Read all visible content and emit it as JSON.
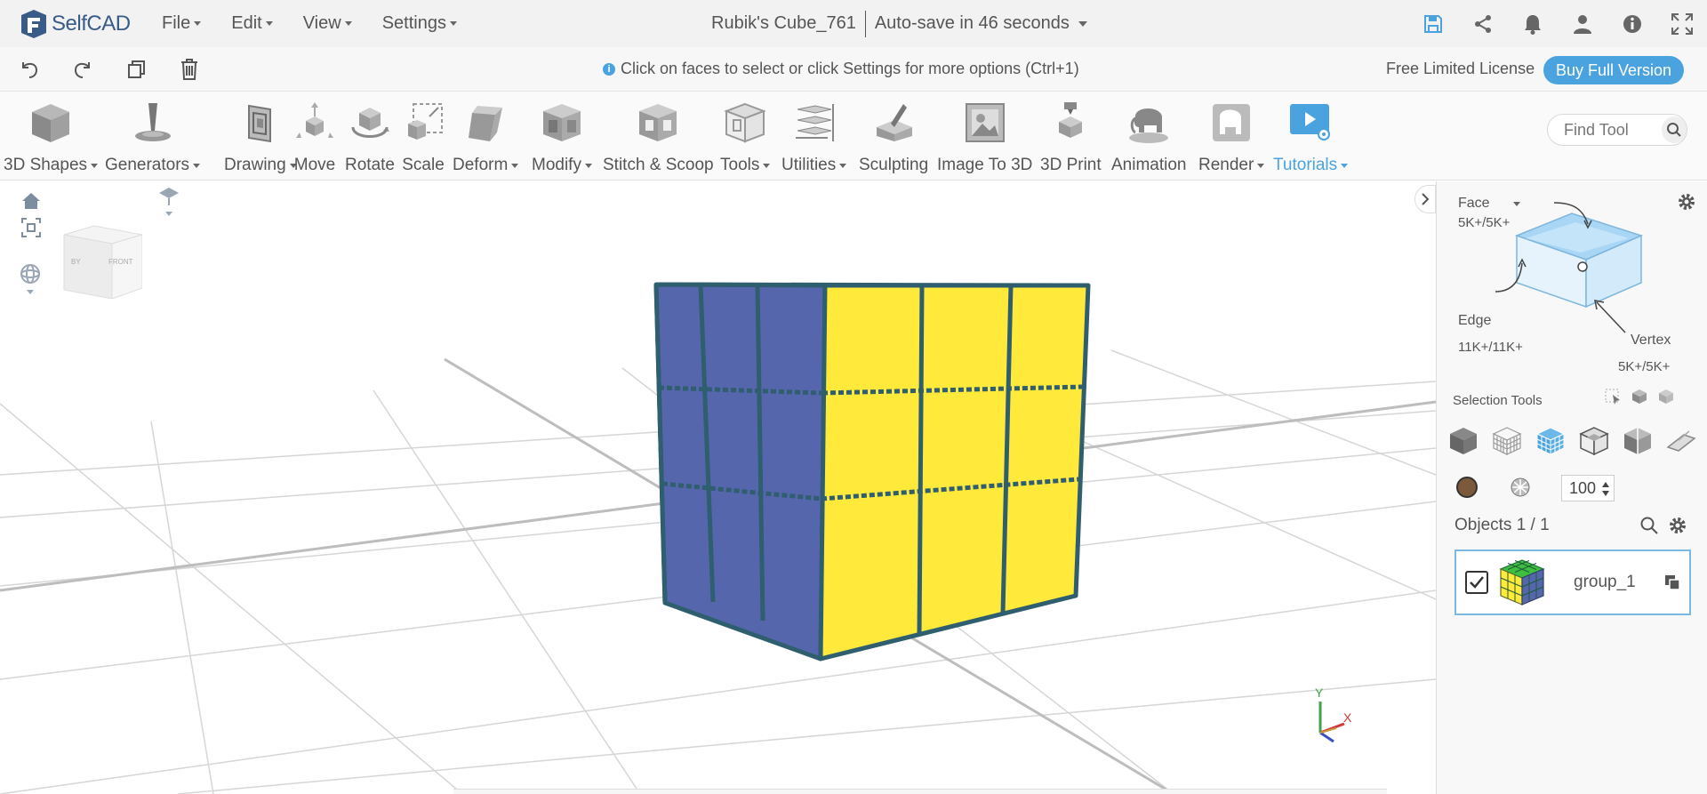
{
  "app": {
    "name": "SelfCAD",
    "brand_color": "#3a5a88",
    "accent_color": "#4aa3df"
  },
  "menu": {
    "items": [
      "File",
      "Edit",
      "View",
      "Settings"
    ]
  },
  "document": {
    "title": "Rubik's Cube_761",
    "autosave": "Auto-save in 46 seconds"
  },
  "top_icons": [
    "save-icon",
    "share-icon",
    "bell-icon",
    "user-icon",
    "info-icon",
    "fullscreen-icon"
  ],
  "actionbar": {
    "icons": [
      "undo-icon",
      "redo-icon",
      "copy-icon",
      "delete-icon"
    ],
    "hint": "Click on faces to select or click Settings for more options (Ctrl+1)",
    "license": "Free Limited License",
    "buy_label": "Buy Full Version"
  },
  "toolbar": {
    "tools": [
      {
        "label": "3D Shapes",
        "dropdown": true
      },
      {
        "label": "Generators",
        "dropdown": true
      },
      {
        "label": "Drawing",
        "dropdown": true
      },
      {
        "label": "Move",
        "dropdown": false
      },
      {
        "label": "Rotate",
        "dropdown": false
      },
      {
        "label": "Scale",
        "dropdown": false
      },
      {
        "label": "Deform",
        "dropdown": true
      },
      {
        "label": "Modify",
        "dropdown": true
      },
      {
        "label": "Stitch & Scoop",
        "dropdown": false
      },
      {
        "label": "Tools",
        "dropdown": true
      },
      {
        "label": "Utilities",
        "dropdown": true
      },
      {
        "label": "Sculpting",
        "dropdown": false
      },
      {
        "label": "Image To 3D",
        "dropdown": false
      },
      {
        "label": "3D Print",
        "dropdown": false
      },
      {
        "label": "Animation",
        "dropdown": false
      },
      {
        "label": "Render",
        "dropdown": true
      },
      {
        "label": "Tutorials",
        "dropdown": true
      }
    ],
    "find_placeholder": "Find Tool"
  },
  "viewport": {
    "navcube_labels": {
      "front": "FRONT",
      "left": "BY"
    },
    "axes": {
      "x": "X",
      "y": "Y"
    },
    "cube_colors": {
      "blue": "#5566ad",
      "yellow": "#ffe93a",
      "edge": "#2f5e6e"
    }
  },
  "panel": {
    "mode": "Face",
    "face_count": "5K+/5K+",
    "edge_label": "Edge",
    "edge_count": "11K+/11K+",
    "vertex_label": "Vertex",
    "vertex_count": "5K+/5K+",
    "selection_tools_label": "Selection Tools",
    "opacity_value": "100",
    "objects_label": "Objects 1 / 1",
    "object_name": "group_1",
    "object_color": "#7a5a3a"
  }
}
